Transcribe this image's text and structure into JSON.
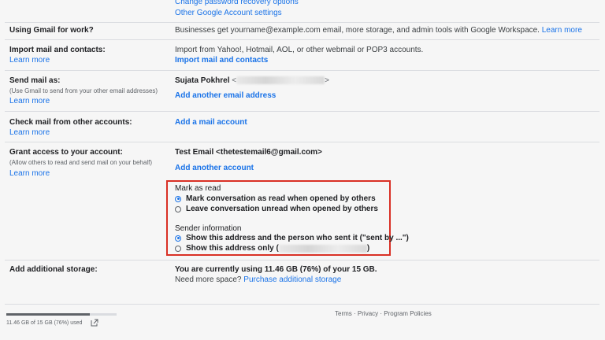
{
  "top_links": {
    "partial": "Change password recovery options",
    "other_settings": "Other Google Account settings"
  },
  "work": {
    "label": "Using Gmail for work?",
    "text": "Businesses get yourname@example.com email, more storage, and admin tools with Google Workspace.",
    "learn_more": "Learn more"
  },
  "import": {
    "label": "Import mail and contacts:",
    "learn_more": "Learn more",
    "text": "Import from Yahoo!, Hotmail, AOL, or other webmail or POP3 accounts.",
    "action": "Import mail and contacts"
  },
  "send_as": {
    "label": "Send mail as:",
    "sub": "(Use Gmail to send from your other email addresses)",
    "learn_more": "Learn more",
    "name": "Sujata Pokhrel",
    "open_bracket": "<",
    "close_bracket": ">",
    "action": "Add another email address"
  },
  "check_mail": {
    "label": "Check mail from other accounts:",
    "learn_more": "Learn more",
    "action": "Add a mail account"
  },
  "grant": {
    "label": "Grant access to your account:",
    "sub": "(Allow others to read and send mail on your behalf)",
    "learn_more": "Learn more",
    "account": "Test Email <thetestemail6@gmail.com>",
    "action": "Add another account",
    "mark_title": "Mark as read",
    "mark_opt1": "Mark conversation as read when opened by others",
    "mark_opt2": "Leave conversation unread when opened by others",
    "sender_title": "Sender information",
    "sender_opt1": "Show this address and the person who sent it (\"sent by ...\")",
    "sender_opt2_prefix": "Show this address only (",
    "sender_opt2_suffix": ")"
  },
  "storage": {
    "label": "Add additional storage:",
    "usage": "You are currently using 11.46 GB (76%) of your 15 GB.",
    "need_more": "Need more space?",
    "purchase": "Purchase additional storage"
  },
  "footer": {
    "terms": "Terms",
    "dot1": "·",
    "privacy": "Privacy",
    "dot2": "·",
    "policies": "Program Policies"
  },
  "storage_indicator": {
    "text": "11.46 GB of 15 GB (76%) used",
    "fraction": 0.76
  },
  "colors": {
    "link": "#1a73e8",
    "highlight": "#d93025"
  }
}
